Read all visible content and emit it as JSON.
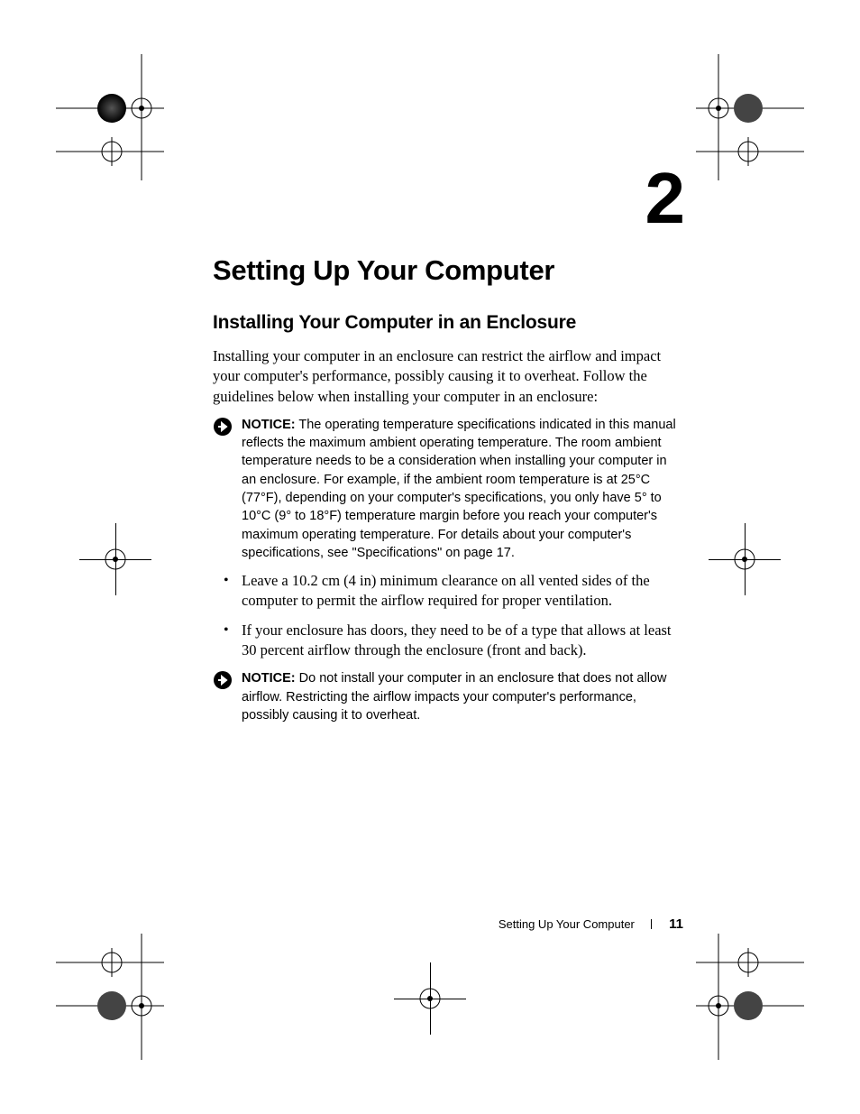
{
  "chapter_number": "2",
  "h1": "Setting Up Your Computer",
  "h2": "Installing Your Computer in an Enclosure",
  "intro": "Installing your computer in an enclosure can restrict the airflow and impact your computer's performance, possibly causing it to overheat. Follow the guidelines below when installing your computer in an enclosure:",
  "notice1_label": "NOTICE:",
  "notice1_body": " The operating temperature specifications indicated in this manual reflects the maximum ambient operating temperature. The room ambient temperature needs to be a consideration when installing your computer in an enclosure. For example, if the ambient room temperature is at 25°C (77°F), depending on your computer's specifications, you only have 5° to 10°C (9° to 18°F) temperature margin before you reach your computer's maximum operating temperature. For details about your computer's specifications, see \"Specifications\" on page 17.",
  "bullets": [
    "Leave a 10.2 cm (4 in) minimum clearance on all vented sides of the computer to permit the airflow required for proper ventilation.",
    "If your enclosure has doors, they need to be of a type that allows at least 30 percent airflow through the enclosure (front and back)."
  ],
  "notice2_label": "NOTICE:",
  "notice2_body": " Do not install your computer in an enclosure that does not allow airflow. Restricting the airflow impacts your computer's performance, possibly causing it to overheat.",
  "footer_title": "Setting Up Your Computer",
  "page_number": "11"
}
